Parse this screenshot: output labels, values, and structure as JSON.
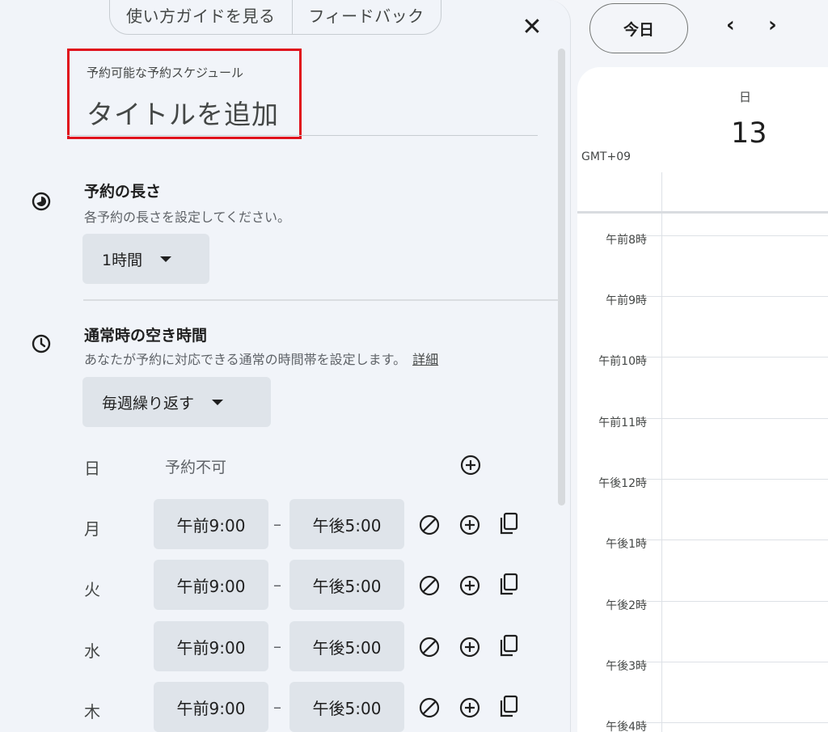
{
  "panel": {
    "top_buttons": [
      "使い方ガイドを見る",
      "フィードバック"
    ],
    "close_symbol": "✕",
    "title_sub": "予約可能な予約スケジュール",
    "title_placeholder": "タイトルを追加"
  },
  "duration": {
    "title": "予約の長さ",
    "desc": "各予約の長さを設定してください。",
    "value": "1時間"
  },
  "availability": {
    "title": "通常時の空き時間",
    "desc": "あなたが予約に対応できる通常の時間帯を設定します。",
    "link": "詳細",
    "repeat": "毎週繰り返す",
    "sunday": {
      "day": "日",
      "status": "予約不可"
    },
    "rows": [
      {
        "day": "月",
        "start": "午前9:00",
        "end": "午後5:00"
      },
      {
        "day": "火",
        "start": "午前9:00",
        "end": "午後5:00"
      },
      {
        "day": "水",
        "start": "午前9:00",
        "end": "午後5:00"
      },
      {
        "day": "木",
        "start": "午前9:00",
        "end": "午後5:00"
      }
    ],
    "dash": "–"
  },
  "calendar": {
    "today": "今日",
    "prev": "‹",
    "next": "›",
    "day_of_week": "日",
    "day_number": "13",
    "timezone": "GMT+09",
    "hours": [
      "午前8時",
      "午前9時",
      "午前10時",
      "午前11時",
      "午後12時",
      "午後1時",
      "午後2時",
      "午後3時",
      "午後4時"
    ]
  },
  "colors": {
    "highlight": "#e0101c",
    "panel_bg": "#f1f4f9",
    "chip_bg": "#dfe4ea"
  }
}
